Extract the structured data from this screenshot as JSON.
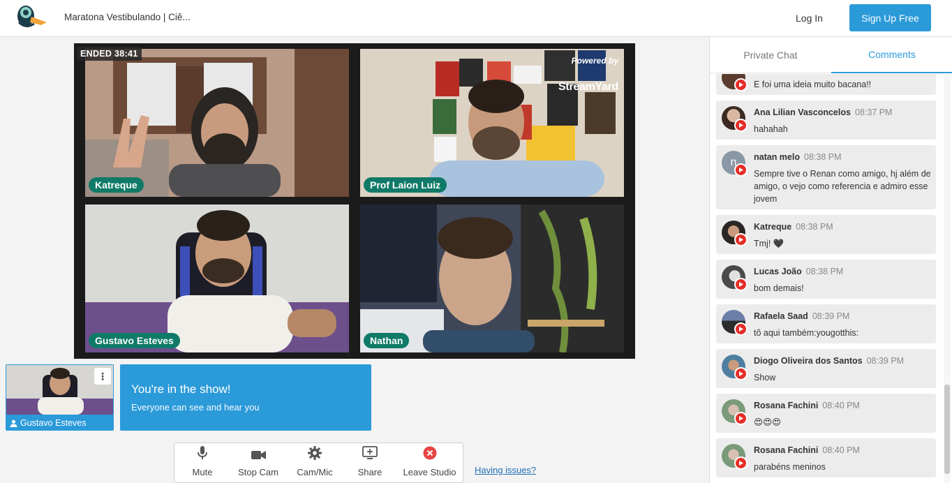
{
  "header": {
    "title": "Maratona Vestibulando | Ciê...",
    "login_label": "Log In",
    "signup_label": "Sign Up Free"
  },
  "stage": {
    "ended_label": "ENDED 38:41",
    "powered_by": "Powered by",
    "brand": "StreamYard",
    "participants": [
      {
        "name": "Katreque"
      },
      {
        "name": "Prof Laion Luiz"
      },
      {
        "name": "Gustavo Esteves"
      },
      {
        "name": "Nathan"
      }
    ]
  },
  "self": {
    "name": "Gustavo Esteves",
    "menu_glyph": "⋮"
  },
  "banner": {
    "heading": "You're in the show!",
    "subtext": "Everyone can see and hear you"
  },
  "controls": {
    "mute": "Mute",
    "stop_cam": "Stop Cam",
    "cam_mic": "Cam/Mic",
    "share": "Share",
    "leave": "Leave Studio",
    "issues": "Having issues?"
  },
  "sidebar": {
    "tabs": [
      "Private Chat",
      "Comments"
    ],
    "active_tab": "Comments",
    "comments": [
      {
        "author": "",
        "time": "",
        "message": "E foi uma ideia muito bacana!!"
      },
      {
        "author": "Ana Lilian Vasconcelos",
        "time": "08:37 PM",
        "message": "hahahah"
      },
      {
        "author": "natan melo",
        "time": "08:38 PM",
        "message": "Sempre tive o Renan como amigo, hj além de amigo, o vejo como referencia e admiro esse jovem",
        "initial": "n"
      },
      {
        "author": "Katreque",
        "time": "08:38 PM",
        "message": "Tmj! 🖤"
      },
      {
        "author": "Lucas João",
        "time": "08:38 PM",
        "message": "bom demais!"
      },
      {
        "author": "Rafaela Saad",
        "time": "08:39 PM",
        "message": "tô aqui também:yougotthis:"
      },
      {
        "author": "Diogo Oliveira dos Santos",
        "time": "08:39 PM",
        "message": "Show"
      },
      {
        "author": "Rosana Fachini",
        "time": "08:40 PM",
        "message": "😍😍😍"
      },
      {
        "author": "Rosana Fachini",
        "time": "08:40 PM",
        "message": "parabéns meninos"
      }
    ]
  },
  "colors": {
    "accent": "#2b9ad9",
    "nameplate": "#0f7a67",
    "youtube": "#e52d27"
  }
}
